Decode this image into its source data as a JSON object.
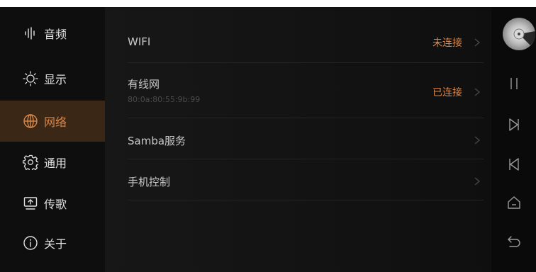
{
  "sidebar": {
    "items": [
      {
        "label": "音频",
        "icon": "audio-wave-icon",
        "active": false
      },
      {
        "label": "显示",
        "icon": "brightness-icon",
        "active": false
      },
      {
        "label": "网络",
        "icon": "globe-icon",
        "active": true
      },
      {
        "label": "通用",
        "icon": "gear-icon",
        "active": false
      },
      {
        "label": "传歌",
        "icon": "upload-monitor-icon",
        "active": false
      },
      {
        "label": "关于",
        "icon": "info-icon",
        "active": false
      }
    ]
  },
  "network": {
    "wifi": {
      "title": "WIFI",
      "status": "未连接"
    },
    "wired": {
      "title": "有线网",
      "mac": "80:0a:80:55:9b:99",
      "status": "已连接"
    },
    "samba": {
      "title": "Samba服务"
    },
    "phone": {
      "title": "手机控制"
    }
  },
  "colors": {
    "accent": "#d7874a",
    "active_bg": "#3a2716",
    "background": "#0b0b0b"
  },
  "controls": {
    "icons": [
      "disc-icon",
      "pause-icon",
      "next-icon",
      "previous-icon",
      "home-icon",
      "back-icon"
    ]
  }
}
